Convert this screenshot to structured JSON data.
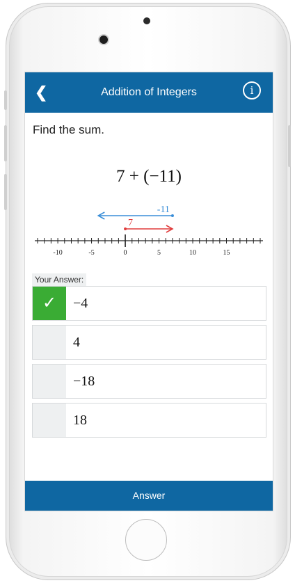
{
  "header": {
    "title": "Addition of Integers",
    "back_icon": "chevron-left-icon",
    "info_glyph": "i"
  },
  "question": {
    "prompt": "Find the sum.",
    "expression": "7 + (−11)"
  },
  "number_line": {
    "min": -13,
    "max": 20,
    "labeled_ticks": [
      -10,
      -5,
      0,
      5,
      10,
      15
    ],
    "tick_labels": [
      "-10",
      "-5",
      "0",
      "5",
      "10",
      "15"
    ],
    "first_arrow": {
      "from": 0,
      "to": 7,
      "label": "7",
      "color": "#e03a3a"
    },
    "second_arrow": {
      "from": 7,
      "to": -4,
      "label": "-11",
      "color": "#3a8ed8"
    }
  },
  "answers": {
    "label": "Your Answer:",
    "options": [
      {
        "value": "−4",
        "checked": true
      },
      {
        "value": "4",
        "checked": false
      },
      {
        "value": "−18",
        "checked": false
      },
      {
        "value": "18",
        "checked": false
      }
    ],
    "check_glyph": "✓"
  },
  "footer": {
    "answer_label": "Answer"
  },
  "colors": {
    "primary": "#0f67a2",
    "correct": "#3aac34",
    "option_box": "#eef0f1"
  }
}
